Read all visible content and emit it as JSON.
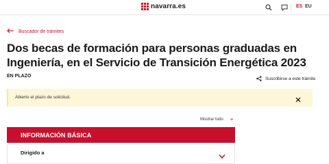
{
  "header": {
    "logo_text": "navarra.es",
    "lang_es": "ES",
    "lang_eu": "EU",
    "brand_color": "#d0021b",
    "icons": [
      "search-icon",
      "chat-icon"
    ]
  },
  "breadcrumb": {
    "back_label": "Buscador de trámites"
  },
  "page": {
    "title": "Dos becas de formación para personas graduadas en Ingeniería, en el Servicio de Transición Energética 2023",
    "status": "EN PLAZO",
    "subscribe_label": "Suscribirse a este trámite"
  },
  "alert": {
    "text": "Abierto el plazo de solicitud."
  },
  "accordion": {
    "show_all": "Mostrar todo",
    "show_all_icon": "+",
    "section_title": "INFORMACIÓN BÁSICA",
    "rows": [
      {
        "label": "Dirigido a"
      }
    ],
    "accent_color": "#c8102e"
  }
}
